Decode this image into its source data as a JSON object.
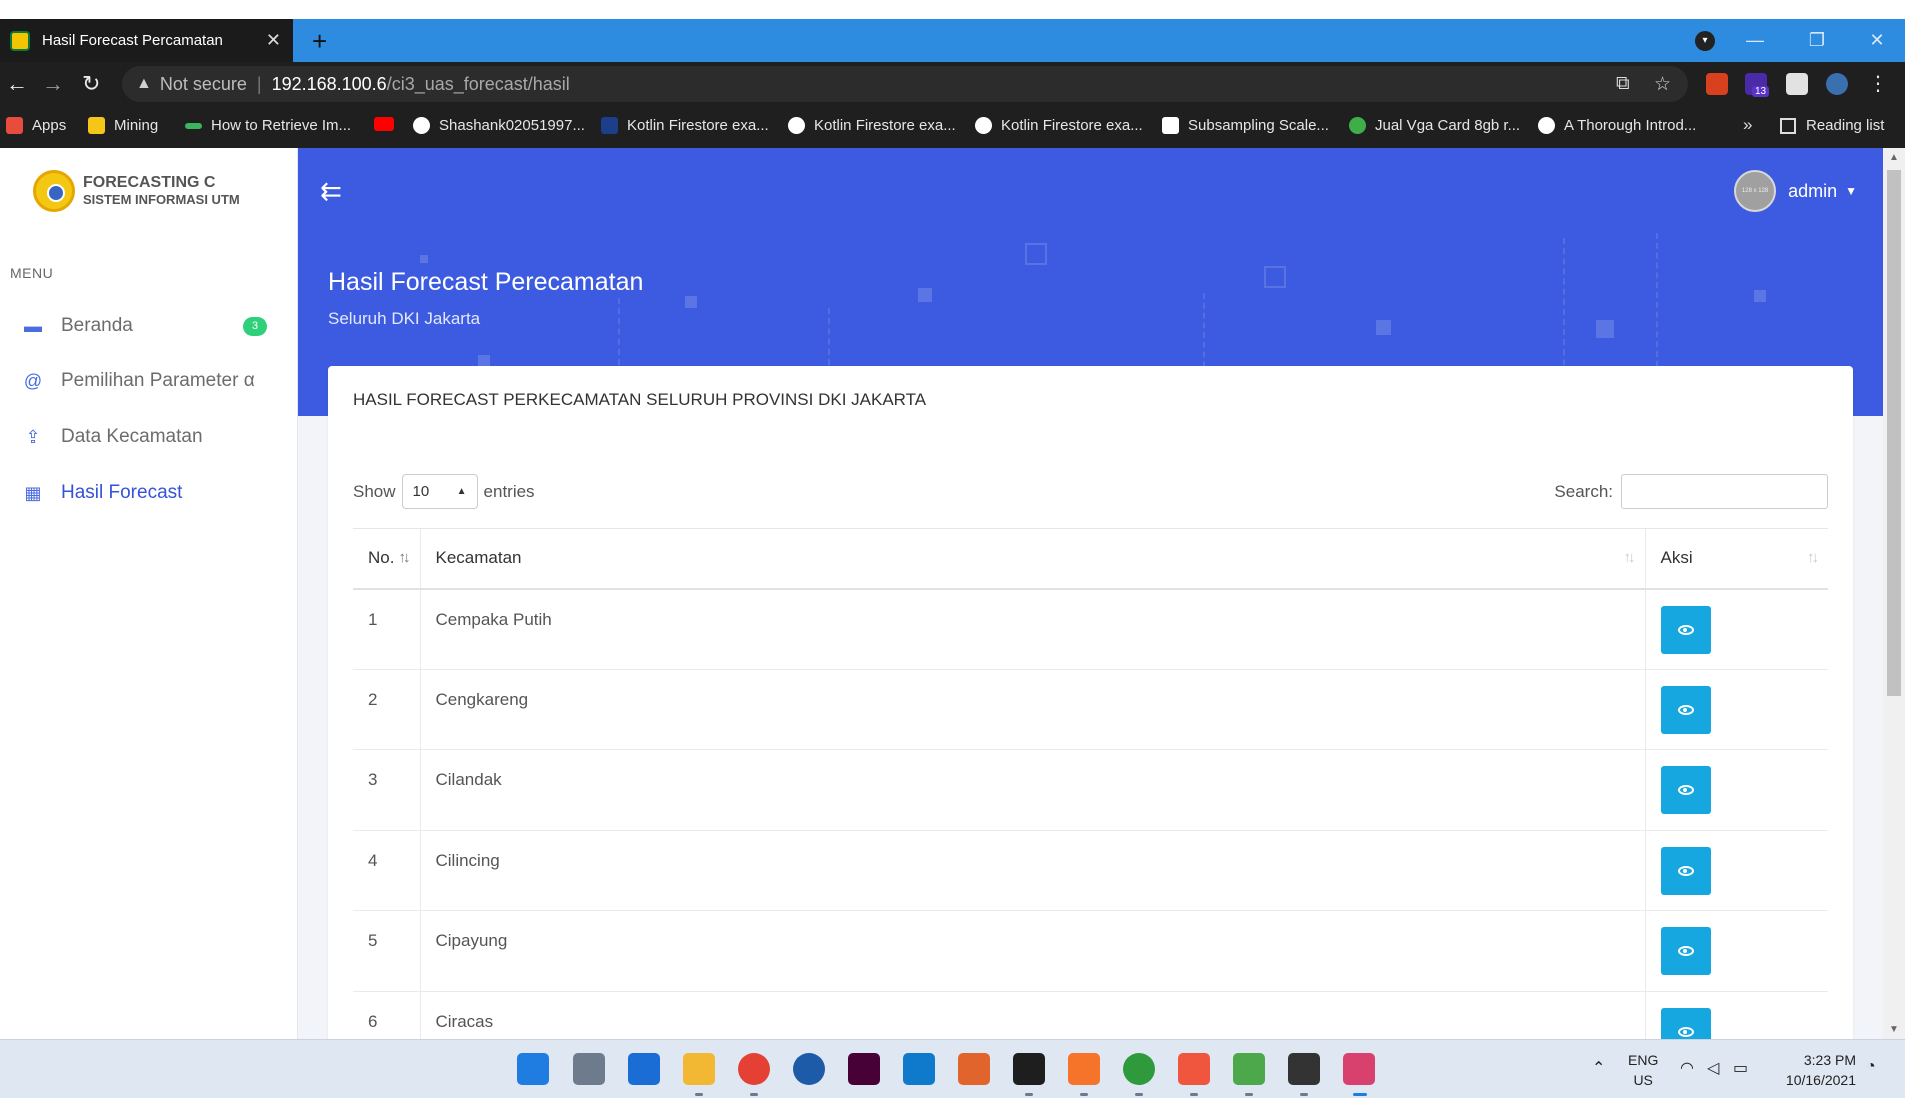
{
  "browser": {
    "tab_title": "Hasil Forecast Percamatan",
    "tab_close": "✕",
    "new_tab": "+",
    "not_secure": "Not secure",
    "separator": "|",
    "url_host": "192.168.100.6",
    "url_path": "/ci3_uas_forecast/hasil",
    "extension_badge": "13",
    "bookmarks": [
      {
        "label": "Apps",
        "color": "#e74c3c"
      },
      {
        "label": "Mining",
        "color": "#f5c518"
      },
      {
        "label": "How to Retrieve Im...",
        "color": "#3bb55f"
      },
      {
        "label": "",
        "color": "#ff0000"
      },
      {
        "label": "Shashank02051997...",
        "color": "#ffffff"
      },
      {
        "label": "Kotlin Firestore exa...",
        "color": "#1d3e8a"
      },
      {
        "label": "Kotlin Firestore exa...",
        "color": "#ffffff"
      },
      {
        "label": "Kotlin Firestore exa...",
        "color": "#ffffff"
      },
      {
        "label": "Subsampling Scale...",
        "color": "#ffffff"
      },
      {
        "label": "Jual Vga Card 8gb r...",
        "color": "#3fae49"
      },
      {
        "label": "A Thorough Introd...",
        "color": "#ffffff"
      }
    ],
    "bookmarks_more": "»",
    "reading_list": "Reading list"
  },
  "sidebar": {
    "logo_line1": "FORECASTING C",
    "logo_line2": "SISTEM INFORMASI UTM",
    "menu_title": "MENU",
    "items": [
      {
        "label": "Beranda",
        "icon": "monitor-icon",
        "badge": "3"
      },
      {
        "label": "Pemilihan Parameter α",
        "icon": "at-icon"
      },
      {
        "label": "Data Kecamatan",
        "icon": "upload-icon"
      },
      {
        "label": "Hasil Forecast",
        "icon": "table-icon"
      }
    ]
  },
  "header": {
    "toggle_icon": "⇇",
    "avatar_text": "128 x 128",
    "user_name": "admin",
    "page_title": "Hasil Forecast Perecamatan",
    "page_subtitle": "Seluruh DKI Jakarta"
  },
  "card": {
    "title": "HASIL FORECAST PERKECAMATAN SELURUH PROVINSI DKI JAKARTA",
    "show_label": "Show",
    "entries_value": "10",
    "entries_label": "entries",
    "search_label": "Search:",
    "search_value": "",
    "columns": [
      "No.",
      "Kecamatan",
      "Aksi"
    ],
    "rows": [
      {
        "no": "1",
        "kecamatan": "Cempaka Putih"
      },
      {
        "no": "2",
        "kecamatan": "Cengkareng"
      },
      {
        "no": "3",
        "kecamatan": "Cilandak"
      },
      {
        "no": "4",
        "kecamatan": "Cilincing"
      },
      {
        "no": "5",
        "kecamatan": "Cipayung"
      },
      {
        "no": "6",
        "kecamatan": "Ciracas"
      }
    ]
  },
  "taskbar": {
    "lang_line1": "ENG",
    "lang_line2": "US",
    "time": "3:23 PM",
    "date": "10/16/2021"
  },
  "colors": {
    "primary": "#3c5be0",
    "view_button": "#17a7e0",
    "badge": "#2fd07a"
  }
}
